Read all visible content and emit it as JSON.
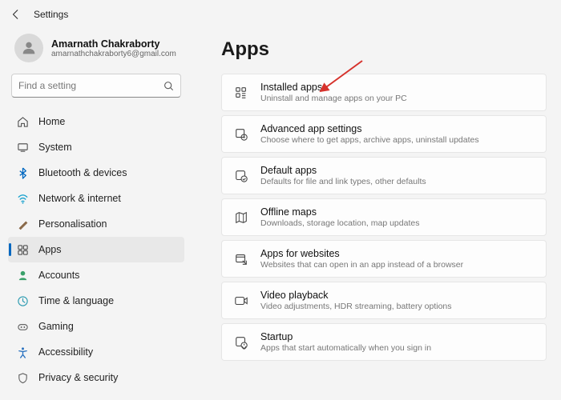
{
  "titlebar": {
    "label": "Settings"
  },
  "profile": {
    "name": "Amarnath Chakraborty",
    "email": "amarnathchakraborty6@gmail.com"
  },
  "search": {
    "placeholder": "Find a setting"
  },
  "nav": [
    {
      "label": "Home"
    },
    {
      "label": "System"
    },
    {
      "label": "Bluetooth & devices"
    },
    {
      "label": "Network & internet"
    },
    {
      "label": "Personalisation"
    },
    {
      "label": "Apps"
    },
    {
      "label": "Accounts"
    },
    {
      "label": "Time & language"
    },
    {
      "label": "Gaming"
    },
    {
      "label": "Accessibility"
    },
    {
      "label": "Privacy & security"
    }
  ],
  "page": {
    "title": "Apps"
  },
  "cards": [
    {
      "title": "Installed apps",
      "desc": "Uninstall and manage apps on your PC"
    },
    {
      "title": "Advanced app settings",
      "desc": "Choose where to get apps, archive apps, uninstall updates"
    },
    {
      "title": "Default apps",
      "desc": "Defaults for file and link types, other defaults"
    },
    {
      "title": "Offline maps",
      "desc": "Downloads, storage location, map updates"
    },
    {
      "title": "Apps for websites",
      "desc": "Websites that can open in an app instead of a browser"
    },
    {
      "title": "Video playback",
      "desc": "Video adjustments, HDR streaming, battery options"
    },
    {
      "title": "Startup",
      "desc": "Apps that start automatically when you sign in"
    }
  ],
  "colors": {
    "accent": "#0067c0",
    "annotation": "#d6322c"
  }
}
